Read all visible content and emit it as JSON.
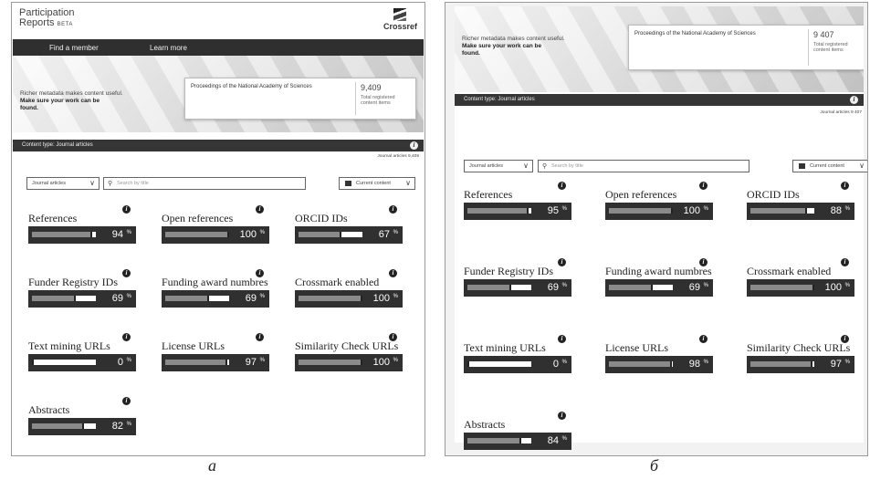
{
  "panel_a": {
    "app_title_line1": "Participation",
    "app_title_line2": "Reports",
    "beta_badge": "BETA",
    "logo_text": "Crossref",
    "nav": [
      "Find a member",
      "Learn more"
    ],
    "tagline_line1": "Richer metadata makes content useful.",
    "tagline_line2": "Make sure your work can be",
    "tagline_line3": "found.",
    "member_name": "Proceedings of the National Academy of Sciences",
    "total_count": "9,409",
    "total_label_1": "Total registered",
    "total_label_2": "content items",
    "content_type": "Content type: Journal articles",
    "journal_total": "Journal articles 9,409",
    "type_select": "Journal articles",
    "search_placeholder": "Search by title",
    "period_select": "Current content",
    "metrics": [
      {
        "label": "References",
        "value": 94,
        "value_text": "94",
        "unit": "%",
        "info": "i"
      },
      {
        "label": "Open references",
        "value": 100,
        "value_text": "100",
        "unit": "%",
        "info": "i"
      },
      {
        "label": "ORCID IDs",
        "value": 67,
        "value_text": "67",
        "unit": "%",
        "info": "i"
      },
      {
        "label": "Funder Registry IDs",
        "value": 69,
        "value_text": "69",
        "unit": "%",
        "info": "i"
      },
      {
        "label": "Funding award numbres",
        "value": 69,
        "value_text": "69",
        "unit": "%",
        "info": "i"
      },
      {
        "label": "Crossmark enabled",
        "value": 100,
        "value_text": "100",
        "unit": "%",
        "info": "i"
      },
      {
        "label": "Text mining URLs",
        "value": 0,
        "value_text": "0",
        "unit": "%",
        "info": "i"
      },
      {
        "label": "License URLs",
        "value": 97,
        "value_text": "97",
        "unit": "%",
        "info": "i"
      },
      {
        "label": "Similarity Check URLs",
        "value": 100,
        "value_text": "100",
        "unit": "%",
        "info": "i"
      },
      {
        "label": "Abstracts",
        "value": 82,
        "value_text": "82",
        "unit": "%",
        "info": "i"
      }
    ],
    "caption": "а"
  },
  "panel_b": {
    "tagline_line1": "Richer metadata makes content useful.",
    "tagline_line2": "Make sure your work can be",
    "tagline_line3": "found.",
    "member_name": "Proceedings of the National Academy of Sciences",
    "total_count": "9 407",
    "total_label_1": "Total registered",
    "total_label_2": "content items",
    "content_type": "Content type: Journal articles",
    "journal_total": "Journal articles 9 407",
    "type_select": "Journal articles",
    "search_placeholder": "Search by title",
    "period_select": "Current content",
    "metrics": [
      {
        "label": "References",
        "value": 95,
        "value_text": "95",
        "unit": "%",
        "info": "i"
      },
      {
        "label": "Open references",
        "value": 100,
        "value_text": "100",
        "unit": "%",
        "info": "i"
      },
      {
        "label": "ORCID IDs",
        "value": 88,
        "value_text": "88",
        "unit": "%",
        "info": "i"
      },
      {
        "label": "Funder Registry IDs",
        "value": 69,
        "value_text": "69",
        "unit": "%",
        "info": "i"
      },
      {
        "label": "Funding award numbres",
        "value": 69,
        "value_text": "69",
        "unit": "%",
        "info": "i"
      },
      {
        "label": "Crossmark enabled",
        "value": 100,
        "value_text": "100",
        "unit": "%",
        "info": "i"
      },
      {
        "label": "Text mining URLs",
        "value": 0,
        "value_text": "0",
        "unit": "%",
        "info": "i"
      },
      {
        "label": "License URLs",
        "value": 98,
        "value_text": "98",
        "unit": "%",
        "info": "i"
      },
      {
        "label": "Similarity Check URLs",
        "value": 97,
        "value_text": "97",
        "unit": "%",
        "info": "i"
      },
      {
        "label": "Abstracts",
        "value": 84,
        "value_text": "84",
        "unit": "%",
        "info": "i"
      }
    ],
    "caption": "б"
  },
  "colors": {
    "bar_bg": "#303030",
    "bar_fill": "#8a8a8a",
    "bar_track": "#ffffff",
    "nav_bg": "#2f2f2f"
  },
  "icons": {
    "info": "info-icon",
    "search": "search-icon",
    "calendar": "calendar-icon",
    "chevron": "chevron-down-icon"
  }
}
